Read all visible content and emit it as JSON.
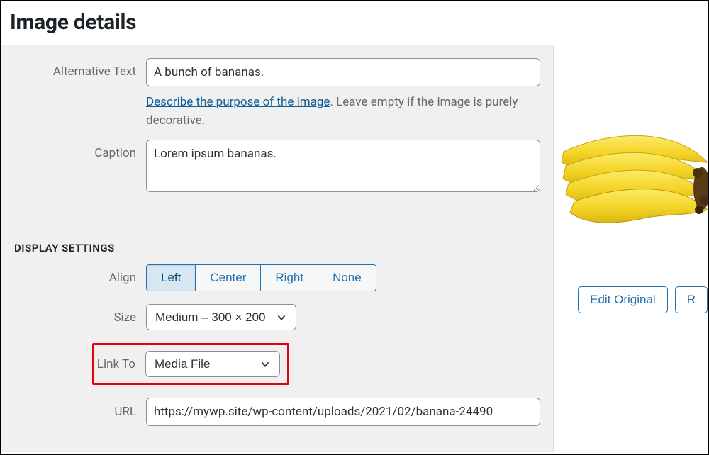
{
  "dialog": {
    "title": "Image details"
  },
  "fields": {
    "alt": {
      "label": "Alternative Text",
      "value": "A bunch of bananas."
    },
    "alt_hint": {
      "link_text": "Describe the purpose of the image",
      "suffix": ". Leave empty if the image is purely decorative."
    },
    "caption": {
      "label": "Caption",
      "value": "Lorem ipsum bananas."
    }
  },
  "display": {
    "heading": "DISPLAY SETTINGS",
    "align": {
      "label": "Align",
      "options": [
        "Left",
        "Center",
        "Right",
        "None"
      ],
      "active": "Left"
    },
    "size": {
      "label": "Size",
      "value": "Medium – 300 × 200"
    },
    "link_to": {
      "label": "Link To",
      "value": "Media File"
    },
    "url": {
      "label": "URL",
      "value": "https://mywp.site/wp-content/uploads/2021/02/banana-24490"
    }
  },
  "right_pane": {
    "edit_original": "Edit Original",
    "replace": "R"
  },
  "colors": {
    "accent": "#2271b1",
    "highlight": "#e3000f",
    "panel_bg": "#f0f0f1",
    "border": "#dcdcde",
    "muted": "#646970"
  }
}
